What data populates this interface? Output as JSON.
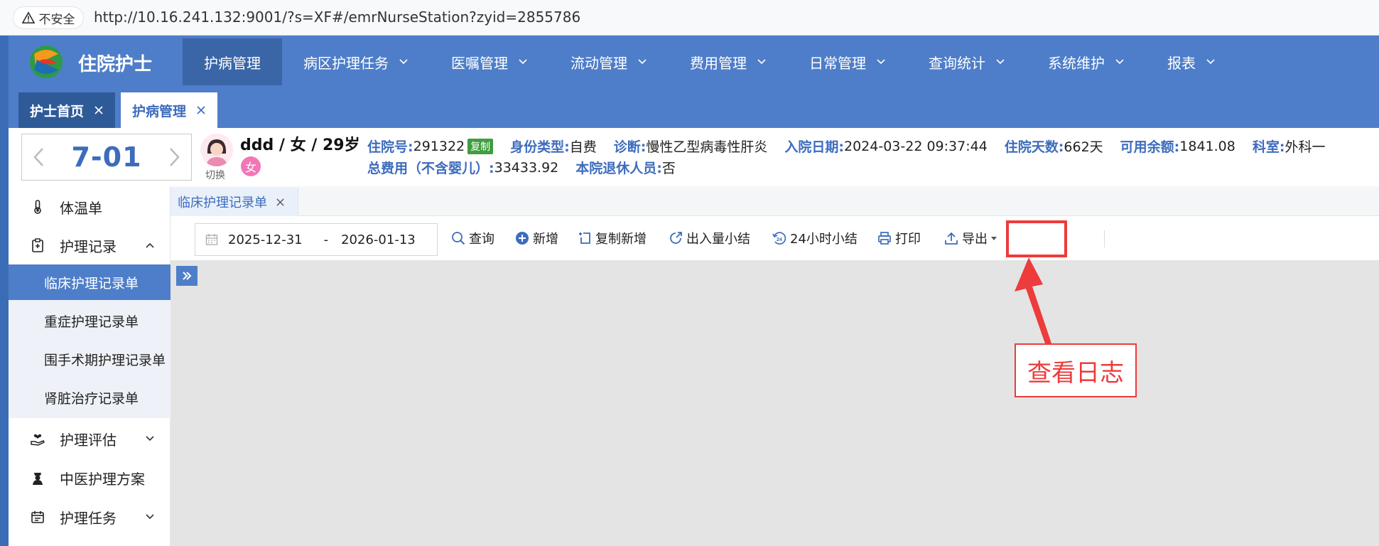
{
  "browser": {
    "insecure_label": "不安全",
    "url": "http://10.16.241.132:9001/?s=XF#/emrNurseStation?zyid=2855786"
  },
  "app": {
    "title": "住院护士",
    "nav": [
      {
        "label": "护病管理",
        "active": true,
        "has_dropdown": false
      },
      {
        "label": "病区护理任务",
        "has_dropdown": true
      },
      {
        "label": "医嘱管理",
        "has_dropdown": true
      },
      {
        "label": "流动管理",
        "has_dropdown": true
      },
      {
        "label": "费用管理",
        "has_dropdown": true
      },
      {
        "label": "日常管理",
        "has_dropdown": true
      },
      {
        "label": "查询统计",
        "has_dropdown": true
      },
      {
        "label": "系统维护",
        "has_dropdown": true
      },
      {
        "label": "报表",
        "has_dropdown": true
      }
    ],
    "tabs": [
      {
        "label": "护士首页"
      },
      {
        "label": "护病管理"
      }
    ]
  },
  "patient": {
    "bed": "7-01",
    "switch_label": "切换",
    "name_line": "ddd / 女 / 29岁",
    "gender_badge": "女",
    "fields_row1": [
      {
        "label": "住院号:",
        "value": "291322",
        "badge": "复制"
      },
      {
        "label": "身份类型:",
        "value": "自费"
      },
      {
        "label": "诊断:",
        "value": "慢性乙型病毒性肝炎"
      },
      {
        "label": "入院日期:",
        "value": "2024-03-22 09:37:44"
      },
      {
        "label": "住院天数:",
        "value": "662天"
      },
      {
        "label": "可用余额:",
        "value": "1841.08"
      },
      {
        "label": "科室:",
        "value": "外科一"
      }
    ],
    "fields_row2": [
      {
        "label": "总费用（不含婴儿）:",
        "value": "33433.92"
      },
      {
        "label": "本院退休人员:",
        "value": "否"
      }
    ]
  },
  "sidebar": {
    "items": [
      {
        "label": "体温单",
        "icon": "thermometer-icon"
      },
      {
        "label": "护理记录",
        "icon": "clipboard-icon",
        "expanded": true
      },
      {
        "label": "护理评估",
        "icon": "hand-heart-icon"
      },
      {
        "label": "中医护理方案",
        "icon": "nurse-icon"
      },
      {
        "label": "护理任务",
        "icon": "calendar-icon"
      }
    ],
    "sub_items": [
      {
        "label": "临床护理记录单",
        "active": true
      },
      {
        "label": "重症护理记录单"
      },
      {
        "label": "围手术期护理记录单"
      },
      {
        "label": "肾脏治疗记录单"
      }
    ]
  },
  "content": {
    "tab_label": "临床护理记录单",
    "date_start": "2025-12-31",
    "date_sep": "-",
    "date_end": "2026-01-13",
    "toolbar": {
      "query": "查询",
      "add": "新增",
      "copy_add": "复制新增",
      "io_summary": "出入量小结",
      "summary_24h": "24小时小结",
      "print": "打印",
      "export": "导出"
    }
  },
  "annotation": {
    "label": "查看日志",
    "color": "#ee3b3b"
  },
  "colors": {
    "primary": "#4e7ec9",
    "primary_dark": "#3a66a8",
    "accent_text": "#3d6cbd"
  }
}
